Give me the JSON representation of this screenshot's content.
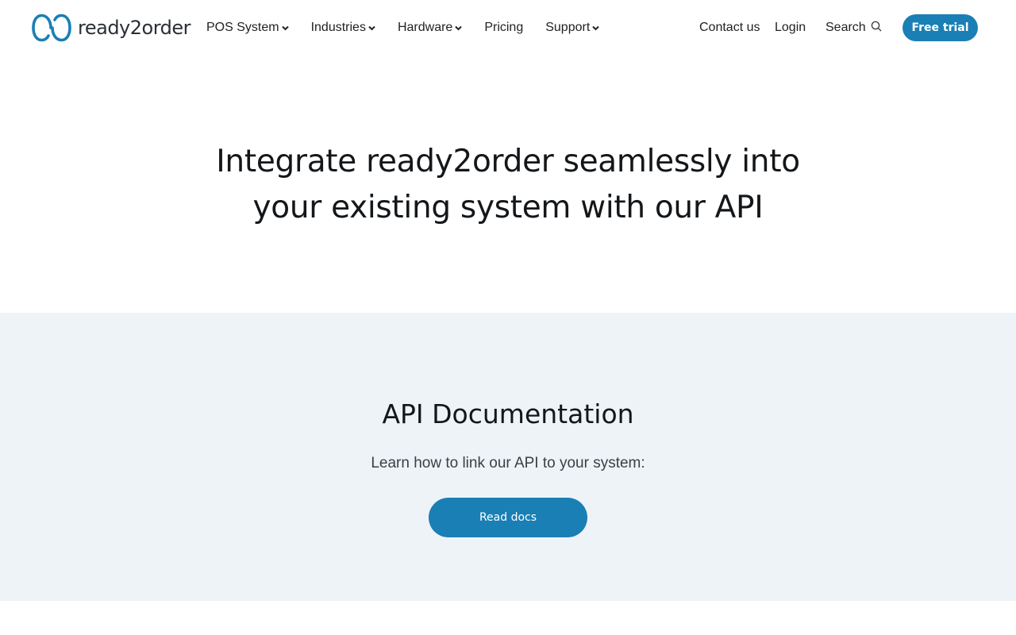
{
  "brand": {
    "name": "ready2order",
    "accent": "#1a7fb4",
    "logo_icon": "interlocking-rings-logo"
  },
  "nav": {
    "items": [
      {
        "label": "POS System",
        "has_dropdown": true
      },
      {
        "label": "Industries",
        "has_dropdown": true
      },
      {
        "label": "Hardware",
        "has_dropdown": true
      },
      {
        "label": "Pricing",
        "has_dropdown": false
      },
      {
        "label": "Support",
        "has_dropdown": true
      }
    ],
    "contact_label": "Contact us",
    "login_label": "Login",
    "search_label": "Search",
    "search_icon": "search-icon",
    "trial_label": "Free trial"
  },
  "hero": {
    "title_line1": "Integrate ready2order seamlessly into",
    "title_line2": "your existing system with our API"
  },
  "api_section": {
    "title": "API Documentation",
    "subtitle": "Learn how to link our API to your system:",
    "button_label": "Read docs",
    "background": "#eef3f7"
  }
}
